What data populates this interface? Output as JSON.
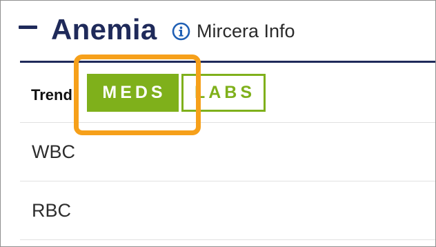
{
  "section": {
    "collapse_icon": "minus-icon",
    "title": "Anemia",
    "info_icon": "info-circle-icon",
    "info_label": "Mircera Info"
  },
  "table": {
    "trend_label": "Trend",
    "rows": [
      {
        "label": "WBC"
      },
      {
        "label": "RBC"
      }
    ]
  },
  "tabs": [
    {
      "label": "MEDS",
      "active": true
    },
    {
      "label": "LABS",
      "active": false
    }
  ],
  "colors": {
    "title": "#1f2a5a",
    "tab_green": "#7fb01b",
    "highlight": "#f6a01a"
  }
}
